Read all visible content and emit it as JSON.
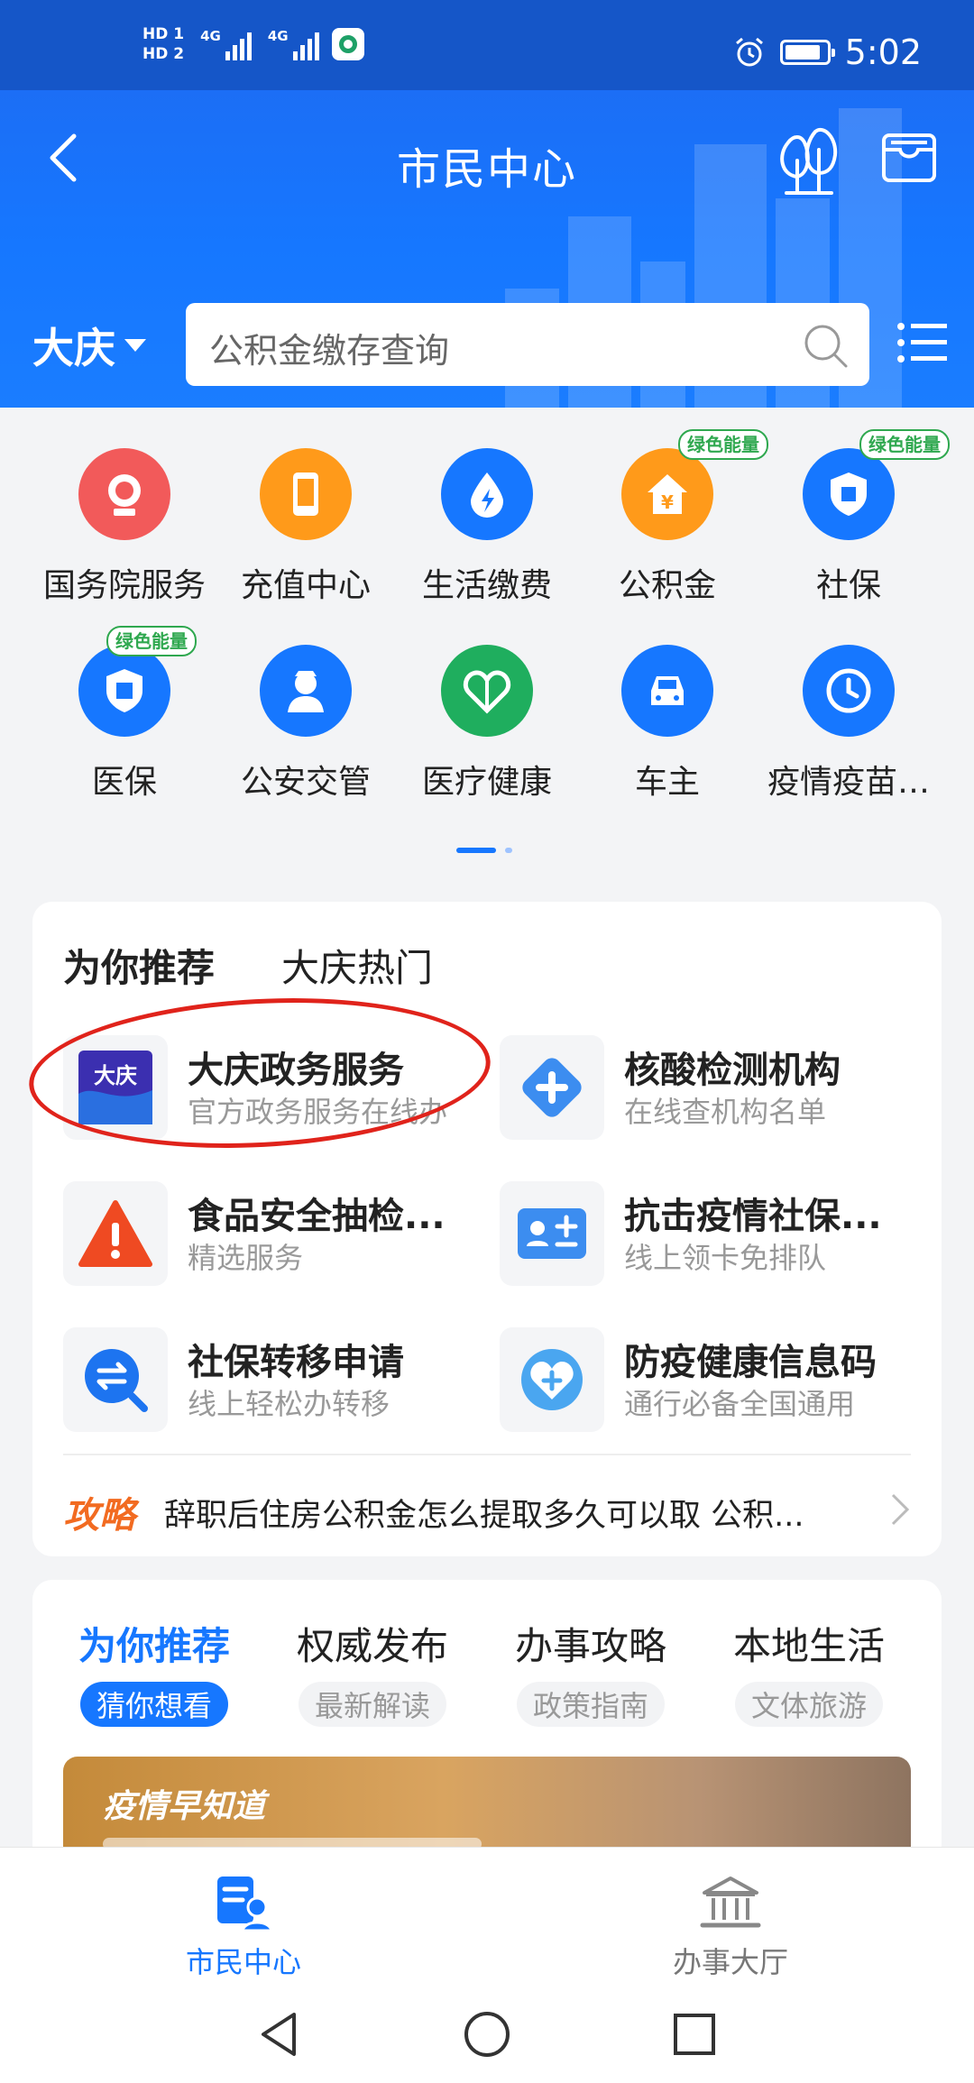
{
  "status_bar": {
    "hd1": "HD 1",
    "hd2": "HD 2",
    "net1": "4G",
    "net2": "4G",
    "time": "5:02"
  },
  "header": {
    "title": "市民中心",
    "city": "大庆",
    "search_placeholder": "公积金缴存查询"
  },
  "services": [
    {
      "label": "国务院服务",
      "icon": "state-council-icon",
      "color": "#f25a5a",
      "badge": ""
    },
    {
      "label": "充值中心",
      "icon": "phone-recharge-icon",
      "color": "#ff9a1a",
      "badge": ""
    },
    {
      "label": "生活缴费",
      "icon": "utility-payment-icon",
      "color": "#1677ff",
      "badge": ""
    },
    {
      "label": "公积金",
      "icon": "housing-fund-icon",
      "color": "#ff9a1a",
      "badge": "绿色能量"
    },
    {
      "label": "社保",
      "icon": "social-security-icon",
      "color": "#1677ff",
      "badge": "绿色能量"
    },
    {
      "label": "医保",
      "icon": "medical-insurance-icon",
      "color": "#1677ff",
      "badge": "绿色能量"
    },
    {
      "label": "公安交管",
      "icon": "police-traffic-icon",
      "color": "#1677ff",
      "badge": ""
    },
    {
      "label": "医疗健康",
      "icon": "healthcare-icon",
      "color": "#1fae5e",
      "badge": ""
    },
    {
      "label": "车主",
      "icon": "car-owner-icon",
      "color": "#1677ff",
      "badge": ""
    },
    {
      "label": "疫情疫苗…",
      "icon": "vaccine-clock-icon",
      "color": "#1677ff",
      "badge": ""
    }
  ],
  "recommend": {
    "tabs": [
      "为你推荐",
      "大庆热门"
    ],
    "items": [
      {
        "name": "大庆政务服务",
        "desc": "官方政务服务在线办",
        "icon": "daqing-gov-icon"
      },
      {
        "name": "核酸检测机构",
        "desc": "在线查机构名单",
        "icon": "medical-cross-icon"
      },
      {
        "name": "食品安全抽检...",
        "desc": "精选服务",
        "icon": "warning-icon"
      },
      {
        "name": "抗击疫情社保...",
        "desc": "线上领卡免排队",
        "icon": "id-card-icon"
      },
      {
        "name": "社保转移申请",
        "desc": "线上轻松办转移",
        "icon": "transfer-icon"
      },
      {
        "name": "防疫健康信息码",
        "desc": "通行必备全国通用",
        "icon": "health-code-icon"
      }
    ],
    "guide_tag": "攻略",
    "guide_text": "辞职后住房公积金怎么提取多久可以取 公积..."
  },
  "feed": {
    "tabs": [
      {
        "title": "为你推荐",
        "sub": "猜你想看"
      },
      {
        "title": "权威发布",
        "sub": "最新解读"
      },
      {
        "title": "办事攻略",
        "sub": "政策指南"
      },
      {
        "title": "本地生活",
        "sub": "文体旅游"
      }
    ],
    "banner_title": "疫情早知道"
  },
  "tabbar": {
    "items": [
      "市民中心",
      "办事大厅"
    ]
  },
  "colors": {
    "primary": "#1677ff",
    "header_dark": "#1556c8",
    "green_badge": "#2fa84f",
    "guide_orange": "#f26b21",
    "highlight_red": "#e0231b"
  }
}
